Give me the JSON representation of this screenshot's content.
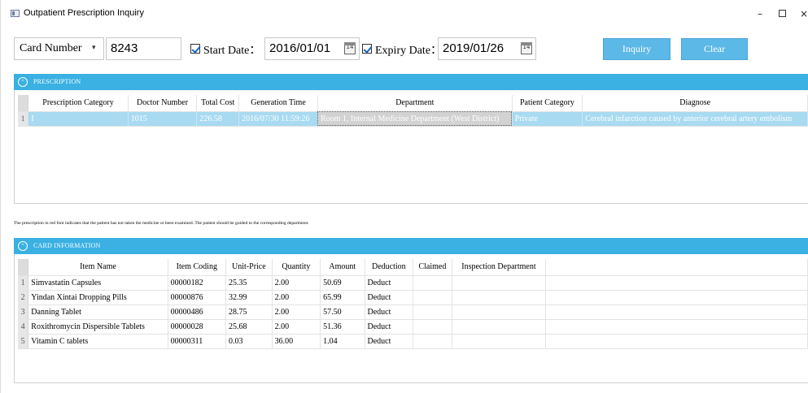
{
  "window": {
    "title": "Outpatient Prescription Inquiry",
    "min_glyph": "–",
    "close_glyph": "×"
  },
  "filters": {
    "field_select": "Card Number",
    "field_select_arrow": "▾",
    "card_number": "8243",
    "start_date_label": "Start Date：",
    "start_date": "2016/01/01",
    "start_checked": true,
    "expiry_date_label": "Expiry Date：",
    "expiry_date": "2019/01/26",
    "expiry_checked": true,
    "calendar_glyph": "14",
    "inquiry_label": "Inquiry",
    "clear_label": "Clear"
  },
  "prescription_panel": {
    "title": "PRESCRIPTION",
    "collapse_glyph": "⌃",
    "columns": [
      "Prescription Category",
      "Doctor Number",
      "Total Cost",
      "Generation Time",
      "Department",
      "Patient Category",
      "Diagnose"
    ],
    "rows": [
      {
        "index": "1",
        "category": "I",
        "doctor_number": "1015",
        "total_cost": "226.58",
        "generation_time": "2016/07/30 11:59:26",
        "department": "Room 1, Internal Medicine Department (West District)",
        "patient_category": "Private",
        "diagnose": "Cerebral infarction caused by anterior cerebral artery embolism"
      }
    ]
  },
  "note": "The prescription in red font indicates that the patient has not taken the medicine or been examined. The patient should be guided to the corresponding department.",
  "card_panel": {
    "title": "CARD INFORMATION",
    "collapse_glyph": "⌃",
    "columns": [
      "Item Name",
      "Item Coding",
      "Unit-Price",
      "Quantity",
      "Amount",
      "Deduction",
      "Claimed",
      "Inspection Department"
    ],
    "rows": [
      {
        "index": "1",
        "item_name": "Simvastatin Capsules",
        "item_coding": "00000182",
        "unit_price": "25.35",
        "quantity": "2.00",
        "amount": "50.69",
        "deduction": "Deduct",
        "claimed": "",
        "inspection_department": ""
      },
      {
        "index": "2",
        "item_name": "Yindan Xintai Dropping Pills",
        "item_coding": "00000876",
        "unit_price": "32.99",
        "quantity": "2.00",
        "amount": "65.99",
        "deduction": "Deduct",
        "claimed": "",
        "inspection_department": ""
      },
      {
        "index": "3",
        "item_name": "Danning Tablet",
        "item_coding": "00000486",
        "unit_price": "28.75",
        "quantity": "2.00",
        "amount": "57.50",
        "deduction": "Deduct",
        "claimed": "",
        "inspection_department": ""
      },
      {
        "index": "4",
        "item_name": "Roxithromycin Dispersible Tablets",
        "item_coding": "00000028",
        "unit_price": "25.68",
        "quantity": "2.00",
        "amount": "51.36",
        "deduction": "Deduct",
        "claimed": "",
        "inspection_department": ""
      },
      {
        "index": "5",
        "item_name": "Vitamin C tablets",
        "item_coding": "00000311",
        "unit_price": "0.03",
        "quantity": "36.00",
        "amount": "1.04",
        "deduction": "Deduct",
        "claimed": "",
        "inspection_department": ""
      }
    ]
  },
  "colors": {
    "accent": "#3ab0e3",
    "button": "#5cb8e6",
    "selected_row": "#a8daf1"
  }
}
